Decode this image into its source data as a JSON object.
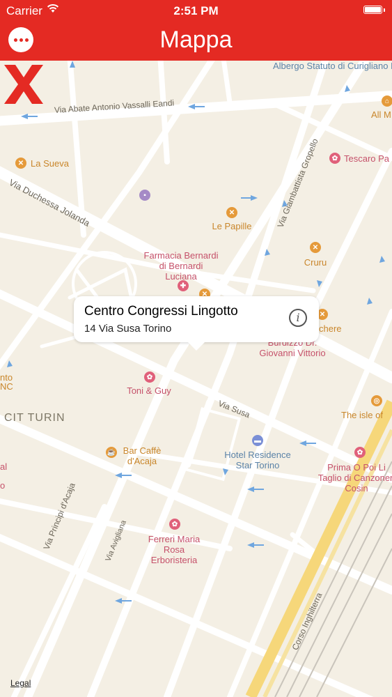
{
  "status_bar": {
    "carrier": "Carrier",
    "time": "2:51 PM",
    "wifi_icon": "wifi-icon",
    "battery_icon": "battery-icon"
  },
  "nav": {
    "title": "Mappa",
    "menu_icon": "more-icon"
  },
  "colors": {
    "accent": "#e42a23",
    "map_bg": "#f4efe4",
    "marker": "#e42a23"
  },
  "map": {
    "streets": {
      "abate": "Via Abate Antonio Vassalli Eandi",
      "duchessa": "Via Duchessa Jolanda",
      "gropello": "Via Giambattista Gropello",
      "susa": "Via Susa",
      "principi": "Via Principi d'Acaja",
      "avigliana": "Via Avigliana",
      "inghilterra": "Corso Inghilterra"
    },
    "areas": {
      "cit_turin": "CIT TURIN"
    },
    "places": {
      "albergo": "Albergo Statuto di Curigliano Rosaria Due Stelle Garage",
      "all_m": "All M",
      "la_sueva": "La Sueva",
      "tescaro": "Tescaro Pa",
      "le_papille": "Le Papille",
      "farmacia": "Farmacia Bernardi di Bernardi Luciana",
      "cruru": "Cruru",
      "chere": "chere",
      "burdizzo": "Burdizzo Dr. Giovanni Vittorio",
      "nto": "nto",
      "nc": "NC",
      "toni_guy": "Toni & Guy",
      "isle": "The isle of",
      "bar_caffe": "Bar Caffè d'Acaja",
      "hotel": "Hotel Residence Star Torino",
      "prima": "Prima O Poi Li Taglio di Canzoneri Cosin",
      "al": "al",
      "o": "o",
      "ferreri": "Ferreri Maria Rosa Erboristeria"
    },
    "callout": {
      "title": "Centro Congressi Lingotto",
      "subtitle": "14 Via Susa Torino",
      "info_icon": "info-icon"
    },
    "legal": "Legal"
  }
}
